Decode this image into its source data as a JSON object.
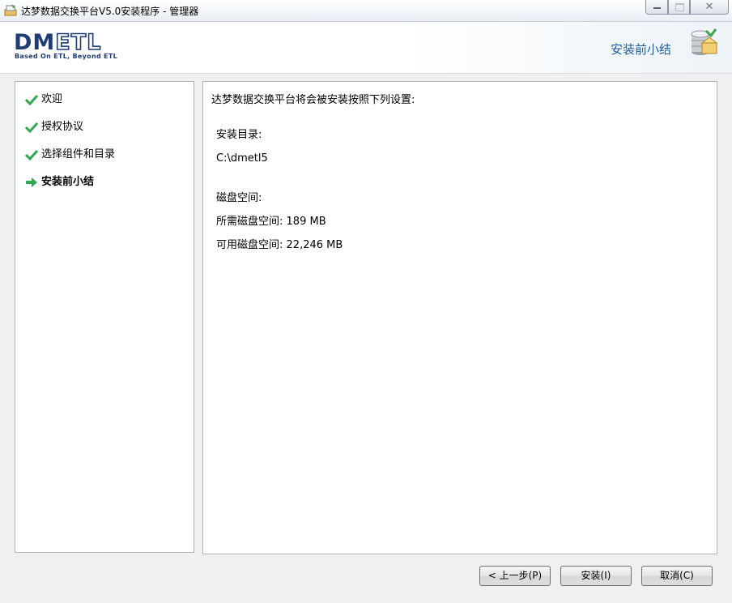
{
  "window": {
    "title": "达梦数据交换平台V5.0安装程序  - 管理器",
    "close_glyph": "✕"
  },
  "header": {
    "logo_main": "DM",
    "logo_etl": "ETL",
    "logo_sub": "Based On ETL, Beyond ETL",
    "step_title": "安装前小结"
  },
  "steps": [
    {
      "label": "欢迎",
      "state": "done"
    },
    {
      "label": "授权协议",
      "state": "done"
    },
    {
      "label": "选择组件和目录",
      "state": "done"
    },
    {
      "label": "安装前小结",
      "state": "current"
    }
  ],
  "summary": {
    "intro": "达梦数据交换平台将会被安装按照下列设置:",
    "install_dir_label": "安装目录:",
    "install_dir_value": "C:\\dmetl5",
    "disk_space_label": "磁盘空间:",
    "required_label": "所需磁盘空间:",
    "required_value": "189 MB",
    "available_label": "可用磁盘空间:",
    "available_value": "22,246 MB"
  },
  "buttons": {
    "back": "< 上一步(P)",
    "install": "安装(I)",
    "cancel": "取消(C)"
  },
  "colors": {
    "brand": "#1f3c77",
    "step_title": "#1f5e9e",
    "check_green": "#2fa84f"
  }
}
